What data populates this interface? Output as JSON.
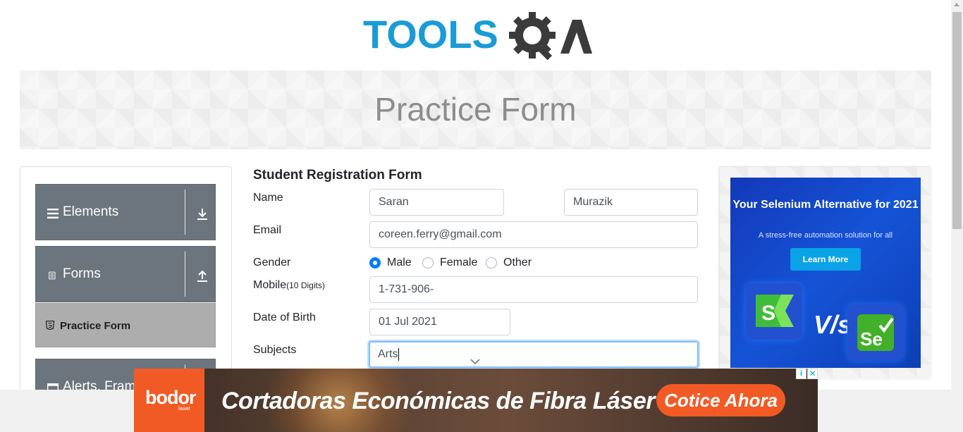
{
  "header": {
    "logo_text_blue": "TOOLS",
    "logo_text_dark": "QA"
  },
  "banner": {
    "title": "Practice Form"
  },
  "sidebar": {
    "groups": [
      {
        "label": "Elements",
        "icon": "hamburger-icon",
        "arrow": "download-icon"
      },
      {
        "label": "Forms",
        "icon": "document-icon",
        "arrow": "upload-icon"
      },
      {
        "label": "Alerts, Fram",
        "icon": "window-icon"
      }
    ],
    "active_item": {
      "label": "Practice Form",
      "icon": "html5-shield-icon"
    }
  },
  "form": {
    "title": "Student Registration Form",
    "name_label": "Name",
    "first_name": "Saran",
    "last_name": "Murazik",
    "email_label": "Email",
    "email": "coreen.ferry@gmail.com",
    "gender_label": "Gender",
    "gender_options": [
      "Male",
      "Female",
      "Other"
    ],
    "gender_selected": "Male",
    "mobile_label": "Mobile",
    "mobile_hint": "(10 Digits)",
    "mobile": "1-731-906-",
    "dob_label": "Date of Birth",
    "dob": "01 Jul 2021",
    "subjects_label": "Subjects",
    "subjects": "Arts"
  },
  "side_ad": {
    "headline": "Your Selenium Alternative for 2021",
    "subline": "A stress-free automation solution for all",
    "cta": "Learn More",
    "vs": "V/s",
    "logo_left": "S",
    "logo_right": "Se"
  },
  "bottom_ad": {
    "brand": "bodor",
    "brand_sub": "laser",
    "text": "Cortadoras Económicas de Fibra Láser",
    "cta": "Cotice Ahora",
    "info": "i",
    "close": "✕"
  },
  "colors": {
    "accent": "#007bff",
    "sidebar_group": "#6c757d",
    "active_item": "#adadad",
    "logo_blue": "#1a9bd7",
    "logo_dark": "#3b3b3b",
    "ad_orange": "#f15a24"
  }
}
